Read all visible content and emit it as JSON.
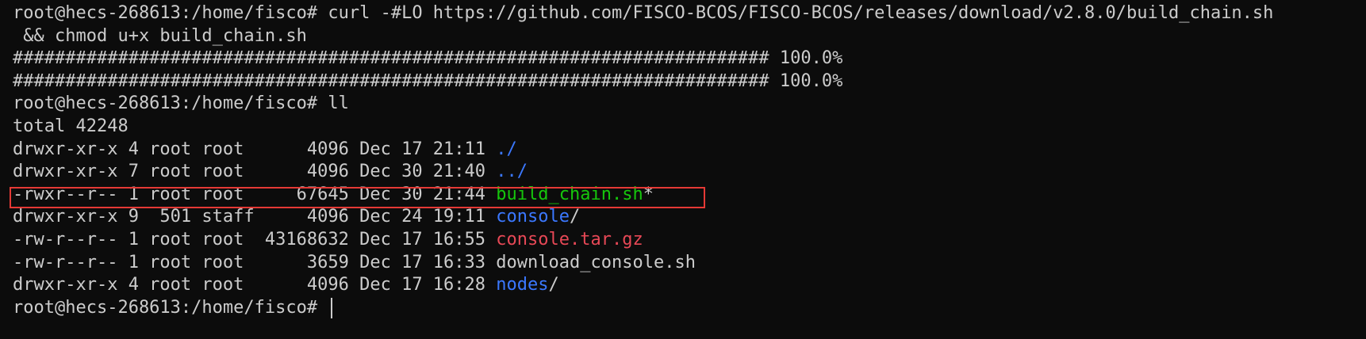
{
  "terminal": {
    "lines": [
      "root@hecs-268613:/home/fisco# curl -#LO https://github.com/FISCO-BCOS/FISCO-BCOS/releases/download/v2.8.0/build_chain.sh",
      " && chmod u+x build_chain.sh",
      "######################################################################## 100.0%",
      "######################################################################## 100.0%",
      "root@hecs-268613:/home/fisco# ll",
      "total 42248"
    ],
    "listing": [
      {
        "meta": "drwxr-xr-x 4 root root      4096 Dec 17 21:11 ",
        "name": "./",
        "suffix": "",
        "color": "blue"
      },
      {
        "meta": "drwxr-xr-x 7 root root      4096 Dec 30 21:40 ",
        "name": "../",
        "suffix": "",
        "color": "blue"
      },
      {
        "meta": "-rwxr--r-- 1 root root     67645 Dec 30 21:44 ",
        "name": "build_chain.sh",
        "suffix": "*",
        "color": "green"
      },
      {
        "meta": "drwxr-xr-x 9  501 staff     4096 Dec 24 19:11 ",
        "name": "console",
        "suffix": "/",
        "color": "blue"
      },
      {
        "meta": "-rw-r--r-- 1 root root  43168632 Dec 17 16:55 ",
        "name": "console.tar.gz",
        "suffix": "",
        "color": "red"
      },
      {
        "meta": "-rw-r--r-- 1 root root      3659 Dec 17 16:33 ",
        "name": "download_console.sh",
        "suffix": "",
        "color": "plain"
      },
      {
        "meta": "drwxr-xr-x 4 root root      4096 Dec 17 16:28 ",
        "name": "nodes",
        "suffix": "/",
        "color": "blue"
      }
    ],
    "prompt": "root@hecs-268613:/home/fisco# ",
    "colors": {
      "background": "#0c0c0c",
      "text": "#cccccc",
      "directory": "#3b78ff",
      "executable": "#16c60c",
      "archive": "#e74856",
      "highlight_border": "#e53935"
    }
  }
}
